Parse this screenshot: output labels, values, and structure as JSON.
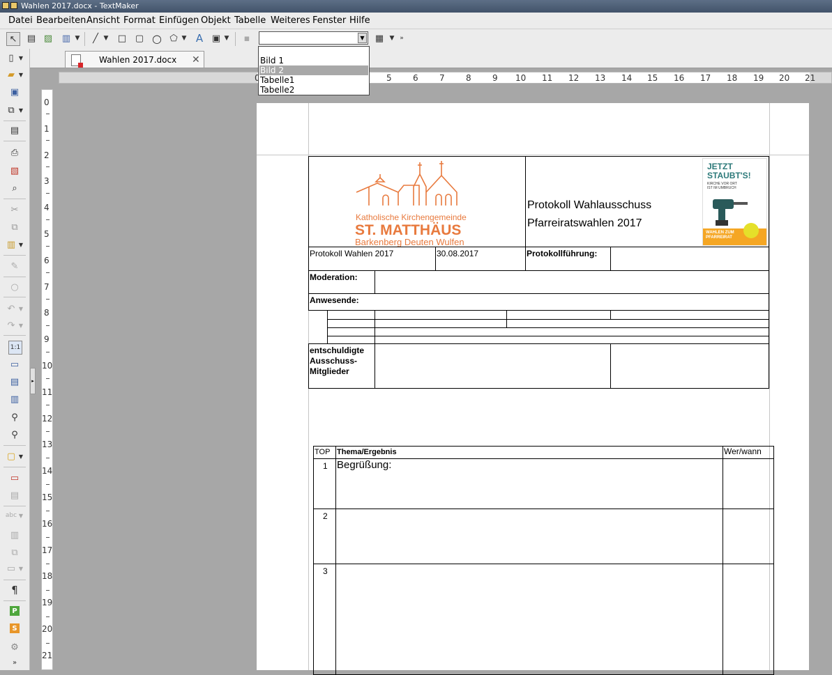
{
  "window": {
    "title": "Wahlen 2017.docx - TextMaker"
  },
  "menu": [
    "Datei",
    "Bearbeiten",
    "Ansicht",
    "Format",
    "Einfügen",
    "Objekt",
    "Tabelle",
    "Weiteres",
    "Fenster",
    "Hilfe"
  ],
  "object_combo": {
    "value": "",
    "options": [
      "Bild 1",
      "Bild 2",
      "Tabelle1",
      "Tabelle2"
    ],
    "highlighted": "Bild 2"
  },
  "tab": {
    "label": "Wahlen 2017.docx"
  },
  "hruler": [
    "5",
    "6",
    "7",
    "8",
    "9",
    "10",
    "11",
    "12",
    "13",
    "14",
    "15",
    "16",
    "17",
    "18",
    "19",
    "20",
    "21"
  ],
  "vruler": [
    "0",
    "1",
    "2",
    "3",
    "4",
    "5",
    "6",
    "7",
    "8",
    "9",
    "10",
    "11",
    "12",
    "13",
    "14",
    "15",
    "16",
    "17",
    "18",
    "19",
    "20",
    "21"
  ],
  "logo": {
    "line1": "Katholische Kirchengemeinde",
    "line2": "ST. MATTHÄUS",
    "line3": "Barkenberg Deuten Wulfen",
    "color": "#e87a3e"
  },
  "poster": {
    "line1": "JETZT",
    "line2": "STAUBT'S!",
    "small1": "KIRCHE VOR ORT",
    "small2": "IST IM UMBRUCH",
    "bottom1": "WAHLEN ZUM",
    "bottom2": "PFARREIRAT",
    "color": "#f5a623",
    "teal": "#2d7a7a"
  },
  "doc": {
    "title1": "Protokoll Wahlausschuss",
    "title2": "Pfarreiratswahlen 2017",
    "protokoll_label": "Protokoll Wahlen 2017",
    "date": "30.08.2017",
    "fuehrung_label": "Protokollführung:",
    "moderation_label": "Moderation:",
    "anwesende_label": "Anwesende:",
    "entschuldigt1": "entschuldigte",
    "entschuldigt2": "Ausschuss-",
    "entschuldigt3": "Mitglieder",
    "top_header": "TOP",
    "thema_header": "Thema/Ergebnis",
    "wer_header": "Wer/wann",
    "rows": [
      {
        "num": "1",
        "text": "Begrüßung:"
      },
      {
        "num": "2",
        "text": ""
      },
      {
        "num": "3",
        "text": ""
      }
    ]
  }
}
